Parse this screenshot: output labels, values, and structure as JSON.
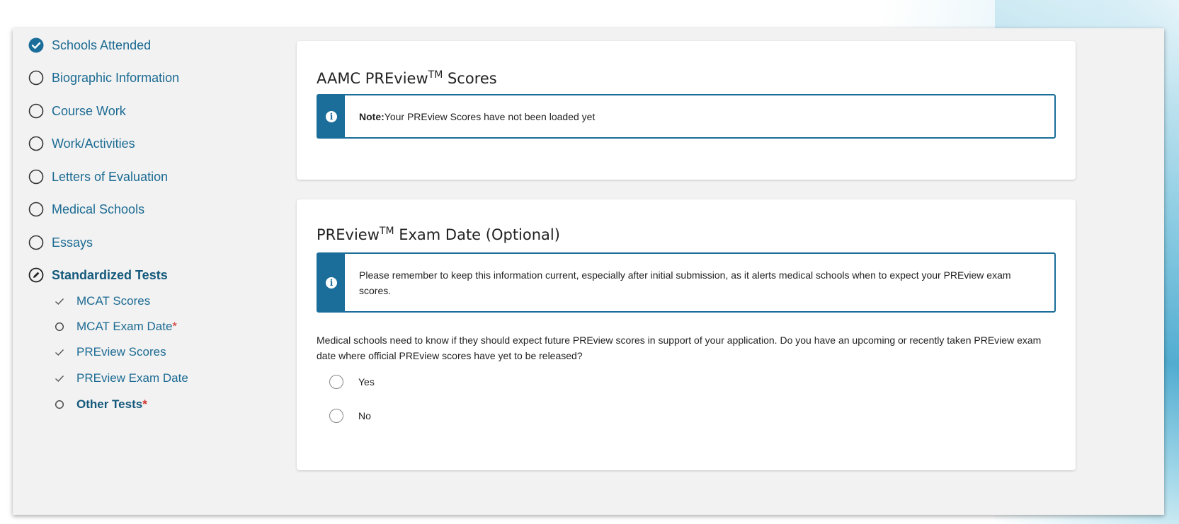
{
  "sidebar": {
    "items": [
      {
        "label": "Schools Attended",
        "status": "complete"
      },
      {
        "label": "Biographic Information",
        "status": "incomplete"
      },
      {
        "label": "Course Work",
        "status": "incomplete"
      },
      {
        "label": "Work/Activities",
        "status": "incomplete"
      },
      {
        "label": "Letters of Evaluation",
        "status": "incomplete"
      },
      {
        "label": "Medical Schools",
        "status": "incomplete"
      },
      {
        "label": "Essays",
        "status": "incomplete"
      },
      {
        "label": "Standardized Tests",
        "status": "editing"
      }
    ],
    "sub_items": [
      {
        "label": "MCAT Scores",
        "status": "complete",
        "required": ""
      },
      {
        "label": "MCAT Exam Date",
        "status": "incomplete",
        "required": "*"
      },
      {
        "label": "PREview Scores",
        "status": "complete",
        "required": ""
      },
      {
        "label": "PREview Exam Date",
        "status": "complete",
        "required": ""
      },
      {
        "label": "Other Tests",
        "status": "incomplete",
        "required": "*"
      }
    ]
  },
  "scores_card": {
    "title": "AAMC PREview",
    "title_sup": "TM",
    "title_suffix": " Scores",
    "alert_bold": "Note:",
    "alert_text": " Your PREview Scores have not been loaded yet"
  },
  "exam_date_card": {
    "title": "PREview",
    "title_sup": "TM",
    "title_suffix": " Exam Date (Optional)",
    "alert_text": "Please remember to keep this information current, especially after initial submission, as it alerts medical schools when to expect your PREview exam scores.",
    "question": "Medical schools need to know if they should expect future PREview scores in support of your application. Do you have an upcoming or recently taken PREview exam date where official PREview scores have yet to be released?",
    "options": [
      "Yes",
      "No"
    ]
  },
  "colors": {
    "accent": "#1a6e99",
    "nav_text": "#1c6b93",
    "required": "#d0312d"
  },
  "icons": {
    "complete": "check-circle-icon",
    "incomplete": "empty-circle-icon",
    "editing": "pencil-circle-icon",
    "sub_complete": "check-icon",
    "sub_incomplete": "small-circle-icon",
    "info": "info-icon"
  }
}
